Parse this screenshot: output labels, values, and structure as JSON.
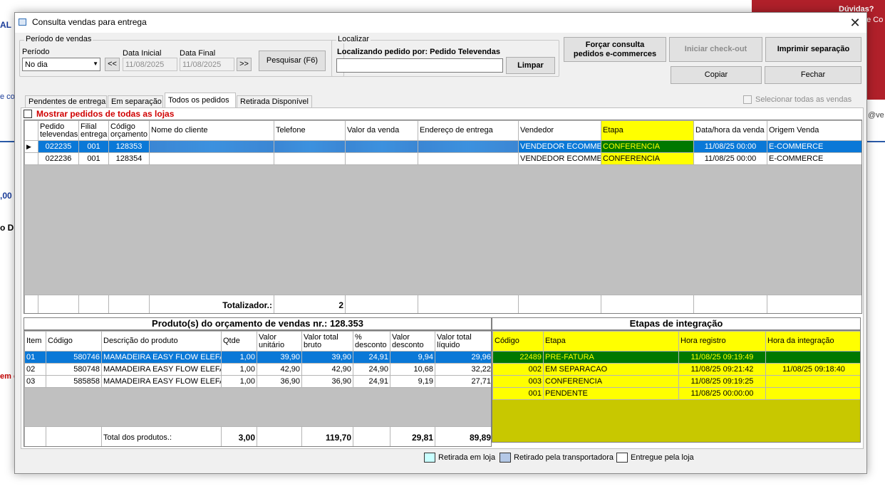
{
  "background": {
    "help_text": "Dúvidas?",
    "help_sub": "de Co",
    "left_fragments": [
      "AL",
      "e co",
      ",00",
      "o D",
      "em c"
    ],
    "right_fragment": "@ve"
  },
  "dialog": {
    "title": "Consulta vendas para entrega",
    "close_glyph": "✕"
  },
  "periodo": {
    "group_label": "Período de vendas",
    "periodo_label": "Período",
    "periodo_value": "No dia",
    "prev_label": "<<",
    "next_label": ">>",
    "data_inicial_label": "Data Inicial",
    "data_inicial_value": "11/08/2025",
    "data_final_label": "Data Final",
    "data_final_value": "11/08/2025",
    "pesquisar_label": "Pesquisar (F6)"
  },
  "localizar": {
    "group_label": "Localizar",
    "localizando_label": "Localizando pedido por: Pedido Televendas",
    "search_value": "",
    "limpar_label": "Limpar"
  },
  "actions": {
    "forcar_line1": "Forçar consulta",
    "forcar_line2": "pedidos e-commerces",
    "iniciar_checkout": "Iniciar check-out",
    "imprimir_separacao": "Imprimir separação",
    "copiar": "Copiar",
    "fechar": "Fechar"
  },
  "tabs": [
    "Pendentes de entrega",
    "Em separação",
    "Todos os pedidos",
    "Retirada Disponível"
  ],
  "selecionar_todas_label": "Selecionar todas as vendas",
  "mostrar_pedidos_label": "Mostrar pedidos de todas as lojas",
  "orders": {
    "headers": {
      "pedido": [
        "Pedido",
        "televendas"
      ],
      "filial": [
        "Filial",
        "entrega"
      ],
      "codigo": [
        "Código",
        "orçamento"
      ],
      "nome": "Nome do cliente",
      "telefone": "Telefone",
      "valor": "Valor da venda",
      "endereco": "Endereço de entrega",
      "vendedor": "Vendedor",
      "etapa": "Etapa",
      "data": "Data/hora da venda",
      "origem": "Origem Venda"
    },
    "rows": [
      {
        "pedido": "022235",
        "filial": "001",
        "codigo": "128353",
        "nome": "",
        "telefone": "",
        "valor": "",
        "endereco": "",
        "vendedor": "VENDEDOR ECOMME",
        "etapa": "CONFERENCIA",
        "data": "11/08/25 00:00",
        "origem": "E-COMMERCE"
      },
      {
        "pedido": "022236",
        "filial": "001",
        "codigo": "128354",
        "nome": "",
        "telefone": "",
        "valor": "",
        "endereco": "",
        "vendedor": "VENDEDOR ECOMME",
        "etapa": "CONFERENCIA",
        "data": "11/08/25 00:00",
        "origem": "E-COMMERCE"
      }
    ],
    "totalizador_label": "Totalizador.:",
    "totalizador_value": "2"
  },
  "produtos": {
    "title": "Produto(s) do orçamento de vendas nr.: 128.353",
    "headers": {
      "item": "Item",
      "codigo": "Código",
      "descricao": "Descrição do produto",
      "qtde": "Qtde",
      "valor_unitario": [
        "Valor",
        "unitário"
      ],
      "valor_total_bruto": [
        "Valor total",
        "bruto"
      ],
      "pct_desconto": [
        "%",
        "desconto"
      ],
      "valor_desconto": [
        "Valor",
        "desconto"
      ],
      "valor_total_liquido": [
        "Valor total",
        "líquido"
      ]
    },
    "rows": [
      {
        "item": "01",
        "codigo": "580746",
        "descricao": "MAMADEIRA EASY FLOW ELEFA",
        "qtde": "1,00",
        "unit": "39,90",
        "bruto": "39,90",
        "pct": "24,91",
        "desc": "9,94",
        "liquido": "29,96"
      },
      {
        "item": "02",
        "codigo": "580748",
        "descricao": "MAMADEIRA EASY FLOW ELEFA",
        "qtde": "1,00",
        "unit": "42,90",
        "bruto": "42,90",
        "pct": "24,90",
        "desc": "10,68",
        "liquido": "32,22"
      },
      {
        "item": "03",
        "codigo": "585858",
        "descricao": "MAMADEIRA EASY FLOW ELEFA",
        "qtde": "1,00",
        "unit": "36,90",
        "bruto": "36,90",
        "pct": "24,91",
        "desc": "9,19",
        "liquido": "27,71"
      }
    ],
    "total_label": "Total dos produtos.:",
    "total_qtde": "3,00",
    "total_bruto": "119,70",
    "total_desconto": "29,81",
    "total_liquido": "89,89"
  },
  "etapas": {
    "title": "Etapas de integração",
    "headers": {
      "codigo": "Código",
      "etapa": "Etapa",
      "hora_registro": "Hora registro",
      "hora_integracao": "Hora da integração"
    },
    "rows": [
      {
        "codigo": "22489",
        "etapa": "PRE-FATURA",
        "hora_registro": "11/08/25 09:19:49",
        "hora_integracao": ""
      },
      {
        "codigo": "002",
        "etapa": "EM SEPARACAO",
        "hora_registro": "11/08/25 09:21:42",
        "hora_integracao": "11/08/25 09:18:40"
      },
      {
        "codigo": "003",
        "etapa": "CONFERENCIA",
        "hora_registro": "11/08/25 09:19:25",
        "hora_integracao": ""
      },
      {
        "codigo": "001",
        "etapa": "PENDENTE",
        "hora_registro": "11/08/25 00:00:00",
        "hora_integracao": ""
      }
    ]
  },
  "legend": {
    "retirada_loja": "Retirada em loja",
    "retirado_transportadora": "Retirado pela transportadora",
    "entregue_loja": "Entregue pela loja"
  },
  "colors": {
    "selection": "#0a78d7",
    "etapa_highlight": "#ffff00",
    "etapa_current": "#007800",
    "etapas_bg": "#c8c800",
    "legend_loja": "#c8ffff",
    "legend_transportadora": "#b4c8e6",
    "legend_entregue": "#ffffff",
    "warning_text": "#d00000"
  }
}
